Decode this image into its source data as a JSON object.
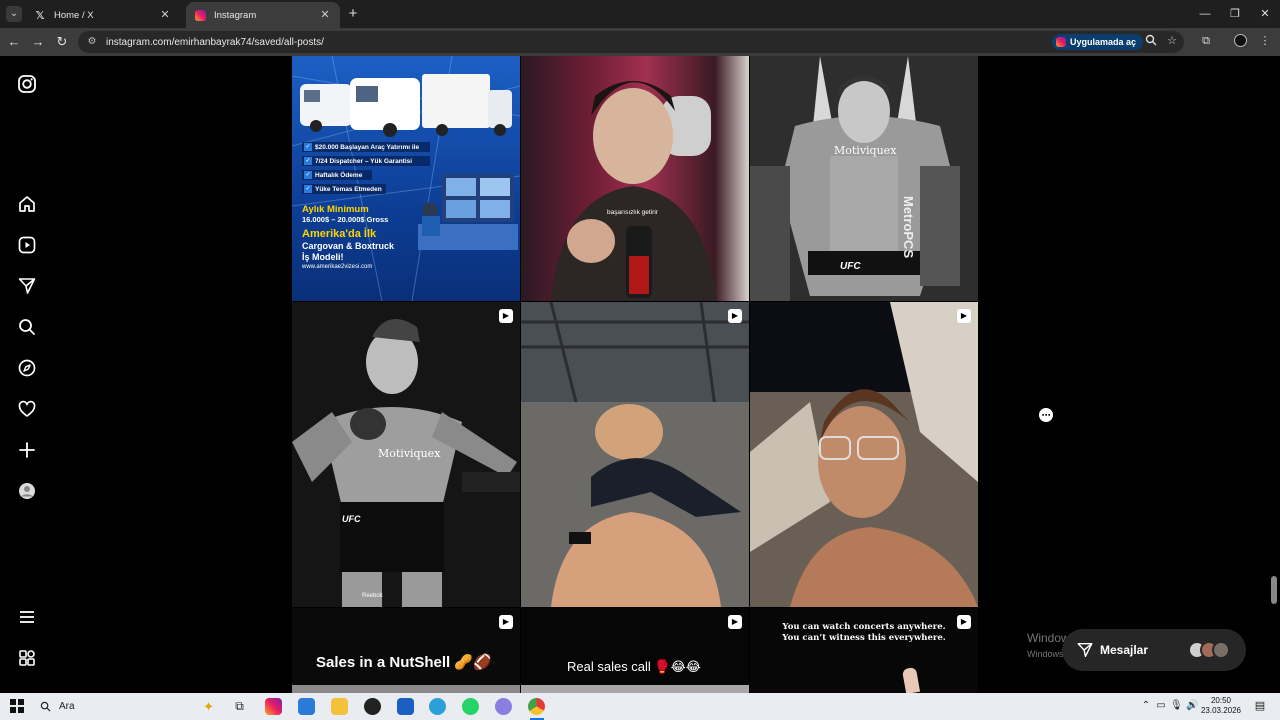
{
  "browser": {
    "tabs": [
      {
        "title": "Home / X",
        "icon": "x-logo-icon",
        "active": false
      },
      {
        "title": "Instagram",
        "icon": "instagram-favicon-icon",
        "active": true
      }
    ],
    "url": "instagram.com/emirhanbayrak74/saved/all-posts/",
    "open_in_app_label": "Uygulamada aç"
  },
  "sidebar": {
    "items": [
      "instagram-logo",
      "home",
      "reels",
      "messages",
      "search",
      "explore",
      "notifications",
      "create",
      "profile",
      "more",
      "also-from-meta"
    ]
  },
  "posts": [
    {
      "type": "image",
      "ad": {
        "lines": [
          "$20.000 Başlayan Araç Yatırımı ile",
          "7/24 Dispatcher – Yük Garantisi",
          "Haftalık Ödeme",
          "Yüke Temas Etmeden"
        ],
        "monthly_label": "Aylık Minimum",
        "monthly_value": "16.000$ – 20.000$ Gross",
        "headline1": "Amerika'da İlk",
        "headline2": "Cargovan & Boxtruck",
        "headline3": "İş Modeli!",
        "website": "www.amerikae2vizesi.com"
      }
    },
    {
      "type": "reel",
      "caption": "başarısızlık getirir"
    },
    {
      "type": "image",
      "caption": "Motiviquex",
      "sponsor": "MetroPCS",
      "brand": "UFC"
    },
    {
      "type": "reel",
      "caption": "Motiviquex",
      "brand": "UFC",
      "sponsor": "Reebok"
    },
    {
      "type": "reel",
      "caption": ""
    },
    {
      "type": "reel",
      "caption": ""
    },
    {
      "type": "reel",
      "caption": "Sales in a NutShell 🥜🏈"
    },
    {
      "type": "reel",
      "caption": "Real sales call 🥊😂😂"
    },
    {
      "type": "reel",
      "caption": "You can watch concerts anywhere.\nYou can’t witness this everywhere."
    }
  ],
  "messages": {
    "label": "Mesajlar"
  },
  "watermark": {
    "line1": "Windows'u Etkinleştir",
    "line2": "Windows'u etkinleştirmek için Ayarlar'a gidin."
  },
  "taskbar": {
    "search_placeholder": "Ara",
    "time": "20:50",
    "date": "23.03.2026"
  },
  "colors": {
    "accent": "#0b3d6e",
    "bg": "#000000",
    "chrome": "#3c3c3c"
  }
}
